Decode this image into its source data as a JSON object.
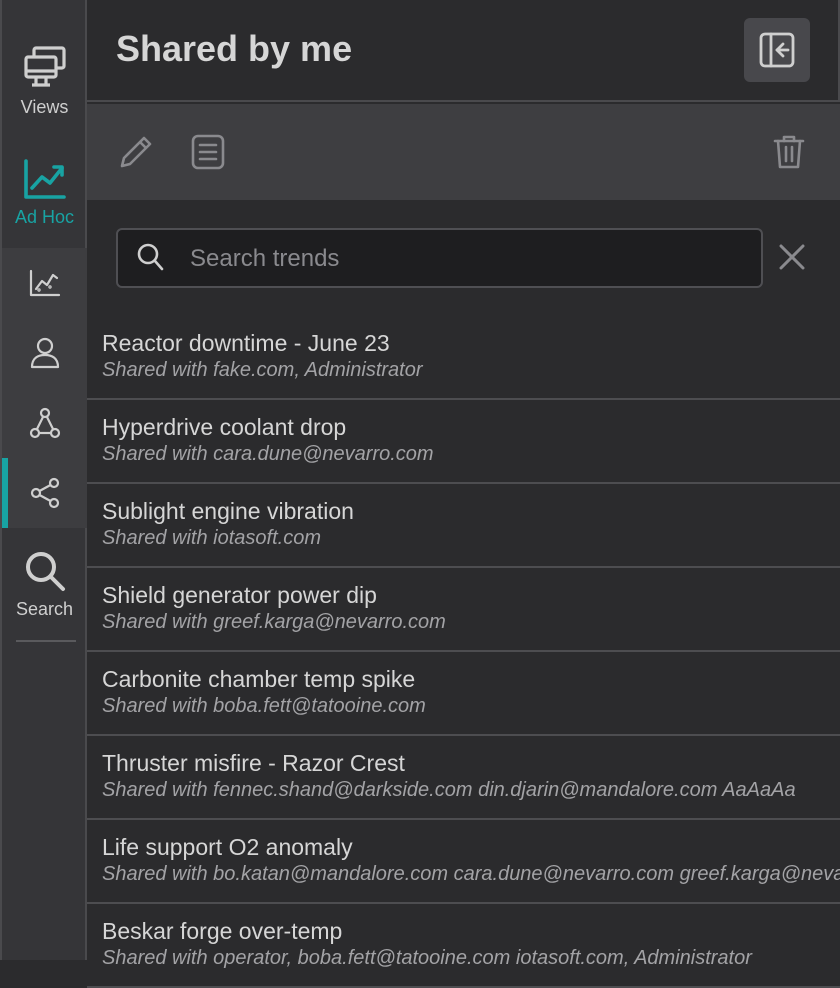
{
  "rail": {
    "views_label": "Views",
    "adhoc_label": "Ad Hoc",
    "search_label": "Search",
    "accent": "#18a3a3",
    "sub_icons": [
      "trend-chart-icon",
      "user-icon",
      "network-triangle-icon",
      "share-icon"
    ]
  },
  "header": {
    "title": "Shared by me",
    "collapse_icon": "collapse-panel-icon"
  },
  "toolbar": {
    "icons": [
      "pencil-icon",
      "document-icon",
      "trash-icon"
    ]
  },
  "search": {
    "placeholder": "Search trends",
    "value": ""
  },
  "items": [
    {
      "name": "Reactor downtime - June 23",
      "shared": "Shared with fake.com, Administrator"
    },
    {
      "name": "Hyperdrive coolant drop",
      "shared": "Shared with cara.dune@nevarro.com"
    },
    {
      "name": "Sublight engine vibration",
      "shared": "Shared with iotasoft.com"
    },
    {
      "name": "Shield generator power dip",
      "shared": "Shared with greef.karga@nevarro.com"
    },
    {
      "name": "Carbonite chamber temp spike",
      "shared": "Shared with boba.fett@tatooine.com"
    },
    {
      "name": "Thruster misfire - Razor Crest",
      "shared": "Shared with fennec.shand@darkside.com din.djarin@mandalore.com AaAaAa"
    },
    {
      "name": "Life support O2 anomaly",
      "shared": "Shared with bo.katan@mandalore.com cara.dune@nevarro.com greef.karga@nevarro.com"
    },
    {
      "name": "Beskar forge over-temp",
      "shared": "Shared with operator, boba.fett@tatooine.com iotasoft.com, Administrator"
    }
  ]
}
